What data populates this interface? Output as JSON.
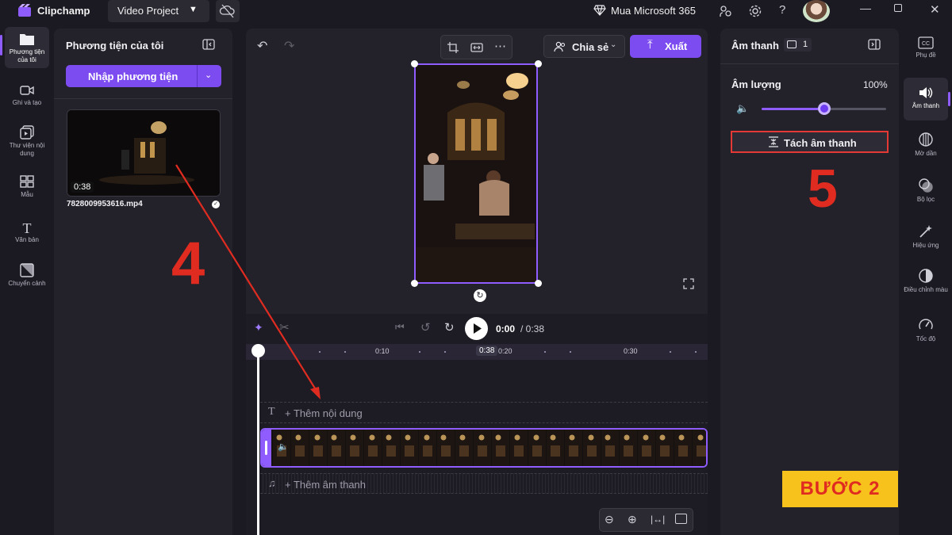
{
  "titlebar": {
    "app_name": "Clipchamp",
    "project_name": "Video Project",
    "promo": "Mua Microsoft 365"
  },
  "left_nav": {
    "items": [
      {
        "label": "Phương tiện của tôi",
        "icon": "media-folder-icon"
      },
      {
        "label": "Ghi và tạo",
        "icon": "camera-icon"
      },
      {
        "label": "Thư viện nội dung",
        "icon": "content-library-icon"
      },
      {
        "label": "Mẫu",
        "icon": "templates-icon"
      },
      {
        "label": "Văn bản",
        "icon": "text-icon"
      },
      {
        "label": "Chuyển cảnh",
        "icon": "transitions-icon"
      }
    ]
  },
  "media_panel": {
    "title": "Phương tiện của tôi",
    "import_label": "Nhập phương tiện",
    "item": {
      "duration": "0:38",
      "filename": "7828009953616.mp4"
    }
  },
  "preview": {
    "share_label": "Chia sẻ",
    "export_label": "Xuất"
  },
  "timeline": {
    "current_time": "0:00",
    "total_time": "/ 0:38",
    "playhead_label": "0:38",
    "ruler_ticks": [
      "0:10",
      "0:20",
      "0:30"
    ],
    "text_track_label": "+ Thêm nội dung",
    "audio_track_label": "+ Thêm âm thanh"
  },
  "right_panel": {
    "title": "Âm thanh",
    "clip_count": "1",
    "volume_label": "Âm lượng",
    "volume_value": "100%",
    "volume_level": 0.5,
    "detach_label": "Tách âm thanh"
  },
  "right_nav": {
    "items": [
      {
        "label": "Phụ đề",
        "icon": "captions-icon"
      },
      {
        "label": "Âm thanh",
        "icon": "speaker-icon"
      },
      {
        "label": "Mờ dần",
        "icon": "fade-icon"
      },
      {
        "label": "Bộ lọc",
        "icon": "filters-icon"
      },
      {
        "label": "Hiệu ứng",
        "icon": "effects-icon"
      },
      {
        "label": "Điều chỉnh màu",
        "icon": "color-adjust-icon"
      },
      {
        "label": "Tốc độ",
        "icon": "speed-icon"
      }
    ]
  },
  "annotations": {
    "step4": "4",
    "step5": "5",
    "banner": "BƯỚC 2"
  },
  "colors": {
    "accent": "#7d4cf0",
    "annotation_red": "#e02c20",
    "banner_yellow": "#f7c21c"
  }
}
